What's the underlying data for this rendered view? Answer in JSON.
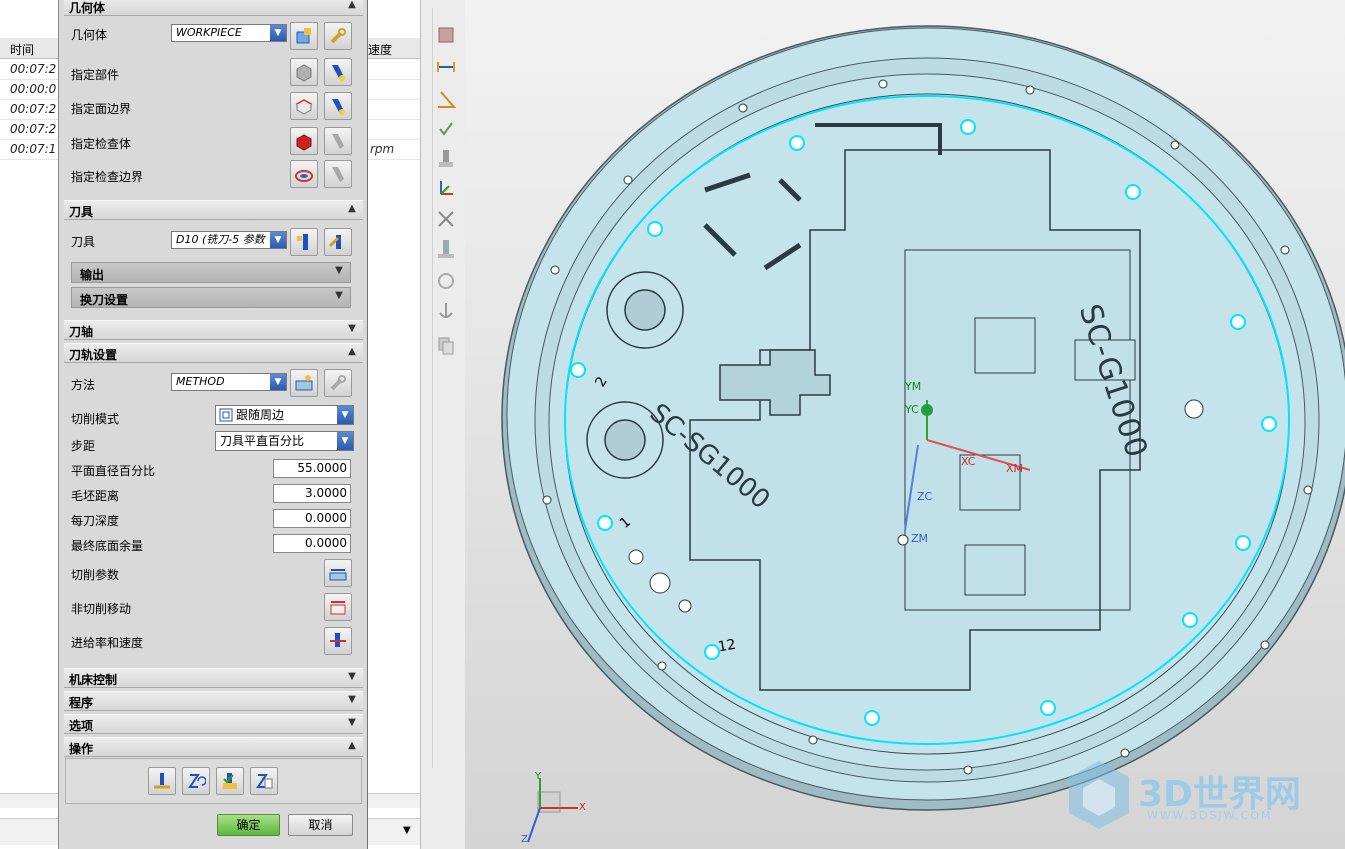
{
  "background_table": {
    "headers": [
      "时间",
      "速度"
    ],
    "times": [
      "00:07:2",
      "00:00:0",
      "00:07:2",
      "00:07:2",
      "00:07:1"
    ],
    "rpm_label": "rpm"
  },
  "dialog": {
    "geometry": {
      "section_title": "几何体",
      "geometry_label": "几何体",
      "geometry_value": "WORKPIECE",
      "specify_part": "指定部件",
      "specify_face_boundary": "指定面边界",
      "specify_check_body": "指定检查体",
      "specify_check_boundary": "指定检查边界"
    },
    "tool": {
      "section_title": "刀具",
      "tool_label": "刀具",
      "tool_value": "D10 (铣刀-5 参数",
      "output": "输出",
      "tool_change": "换刀设置"
    },
    "tool_axis": {
      "section_title": "刀轴"
    },
    "path_settings": {
      "section_title": "刀轨设置",
      "method_label": "方法",
      "method_value": "METHOD",
      "cut_pattern_label": "切削模式",
      "cut_pattern_value": "跟随周边",
      "stepover_label": "步距",
      "stepover_value": "刀具平直百分比",
      "flat_diameter_label": "平面直径百分比",
      "flat_diameter_value": "55.0000",
      "blank_distance_label": "毛坯距离",
      "blank_distance_value": "3.0000",
      "depth_per_cut_label": "每刀深度",
      "depth_per_cut_value": "0.0000",
      "final_floor_stock_label": "最终底面余量",
      "final_floor_stock_value": "0.0000",
      "cutting_params": "切削参数",
      "non_cutting_moves": "非切削移动",
      "feeds_speeds": "进给率和速度"
    },
    "machine_control": {
      "section_title": "机床控制"
    },
    "program": {
      "section_title": "程序"
    },
    "options": {
      "section_title": "选项"
    },
    "actions": {
      "section_title": "操作"
    },
    "buttons": {
      "ok": "确定",
      "cancel": "取消"
    }
  },
  "viewport": {
    "part_label_a": "SC-G1000",
    "part_label_b": "SC-SG1000",
    "axes": {
      "ym": "YM",
      "yc": "YC",
      "xc": "XC",
      "xm": "XM",
      "zc": "ZC",
      "zm": "ZM"
    },
    "hole_numbers": [
      "2",
      "1",
      "12"
    ],
    "triad": {
      "x": "X",
      "y": "Y",
      "z": "Z"
    },
    "watermark": "3D世界网",
    "watermark_url": "WWW.3DSJW.COM"
  },
  "colors": {
    "part_fill": "#c5e3ea",
    "toolpath": "#00e5ff",
    "dialog_bg": "#d9d9d9",
    "ok_button": "#6cc04a"
  }
}
